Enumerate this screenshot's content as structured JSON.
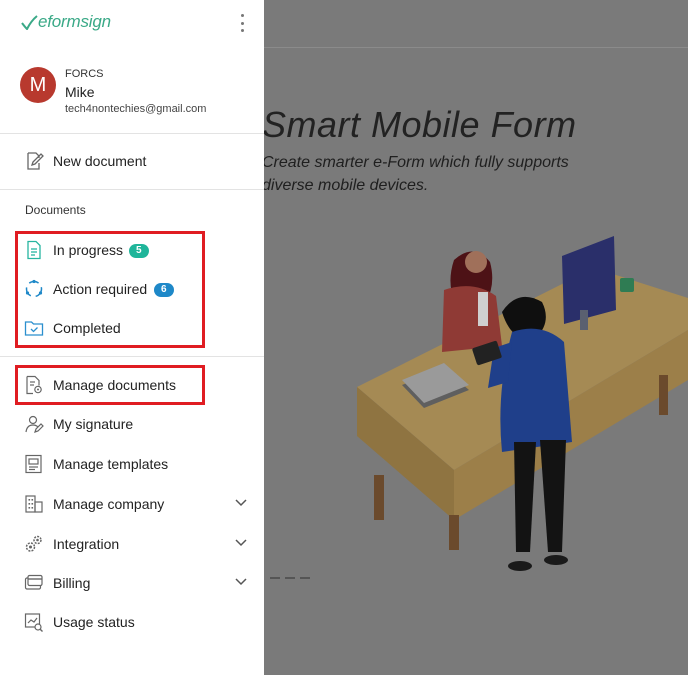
{
  "background": {
    "hero_title": "Smart Mobile Form",
    "hero_subtitle": "Create smarter e-Form which fully supports diverse mobile devices."
  },
  "drawer": {
    "logo_text": "eformsign",
    "user": {
      "initial": "M",
      "company": "FORCS",
      "name": "Mike",
      "email": "tech4nontechies@gmail.com"
    },
    "new_document": "New document",
    "documents_section": "Documents",
    "documents": [
      {
        "label": "In progress",
        "icon": "document-list-icon",
        "badge": "5",
        "badge_color": "#1fb59a"
      },
      {
        "label": "Action required",
        "icon": "cycle-arrows-icon",
        "badge": "6",
        "badge_color": "#1e88c8"
      },
      {
        "label": "Completed",
        "icon": "folder-check-icon"
      }
    ],
    "menu": [
      {
        "label": "Manage documents",
        "icon": "document-gear-icon"
      },
      {
        "label": "My signature",
        "icon": "signature-pen-icon"
      },
      {
        "label": "Manage templates",
        "icon": "template-icon"
      },
      {
        "label": "Manage company",
        "icon": "building-icon",
        "expandable": true
      },
      {
        "label": "Integration",
        "icon": "gears-icon",
        "expandable": true
      },
      {
        "label": "Billing",
        "icon": "wallet-card-icon",
        "expandable": true
      },
      {
        "label": "Usage status",
        "icon": "chart-search-icon"
      }
    ]
  },
  "colors": {
    "brand": "#3aa987",
    "highlight": "#e01c22",
    "avatar": "#b8392e"
  }
}
